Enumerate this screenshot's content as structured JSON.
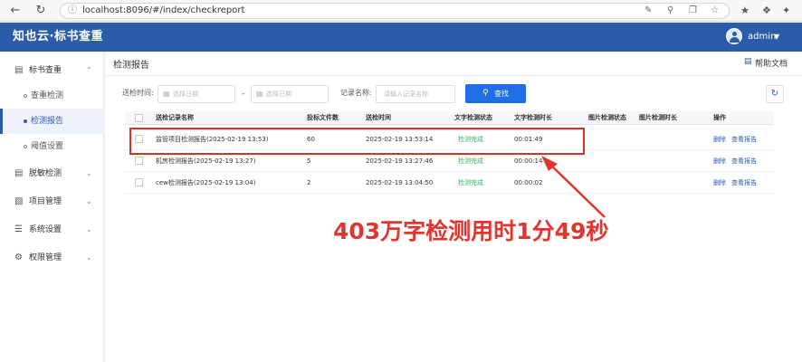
{
  "browser": {
    "url": "localhost:8096/#/index/checkreport"
  },
  "app": {
    "logo": "知也云·标书查重",
    "user": "admin"
  },
  "sidebar": {
    "items": [
      {
        "label": "标书查重",
        "icon": "document-icon",
        "expanded": true,
        "children": [
          {
            "label": "查重检测",
            "active": false
          },
          {
            "label": "检测报告",
            "active": true
          },
          {
            "label": "阈值设置",
            "active": false
          }
        ]
      },
      {
        "label": "脱敏检测",
        "icon": "document-icon"
      },
      {
        "label": "项目管理",
        "icon": "folder-icon"
      },
      {
        "label": "系统设置",
        "icon": "list-icon"
      },
      {
        "label": "权限管理",
        "icon": "gear-icon"
      }
    ]
  },
  "main": {
    "title": "检测报告",
    "help": "帮助文档",
    "filters": {
      "time_label": "送检时间:",
      "start_placeholder": "选择日期",
      "dash": "-",
      "end_placeholder": "选择日期",
      "name_label": "记录名称:",
      "name_placeholder": "请输入记录名称",
      "search_label": "查找"
    },
    "table": {
      "columns": [
        "送检记录名称",
        "投标文件数",
        "送检时间",
        "文字检测状态",
        "文字检测时长",
        "图片检测状态",
        "图片检测时长",
        "操作"
      ],
      "rows": [
        {
          "name": "监管项目检测报告(2025-02-19 13:53)",
          "files": "60",
          "time": "2025-02-19 13:53:14",
          "text_status": "检测完成",
          "text_duration": "00:01:49",
          "img_status": "",
          "img_duration": "",
          "delete": "删除",
          "view": "查看报告"
        },
        {
          "name": "机房检测报告(2025-02-19 13:27)",
          "files": "5",
          "time": "2025-02-19 13:27:46",
          "text_status": "检测完成",
          "text_duration": "00:00:14",
          "img_status": "",
          "img_duration": "",
          "delete": "删除",
          "view": "查看报告"
        },
        {
          "name": "cew检测报告(2025-02-19 13:04)",
          "files": "2",
          "time": "2025-02-19 13:04:50",
          "text_status": "检测完成",
          "text_duration": "00:00:02",
          "img_status": "",
          "img_duration": "",
          "delete": "删除",
          "view": "查看报告"
        }
      ]
    }
  },
  "annotation": {
    "text": "403万字检测用时1分49秒",
    "color": "#e0362e"
  },
  "colors": {
    "brand": "#2a5caa",
    "primary_button": "#1e6ee6",
    "status_ok": "#34b35a"
  }
}
